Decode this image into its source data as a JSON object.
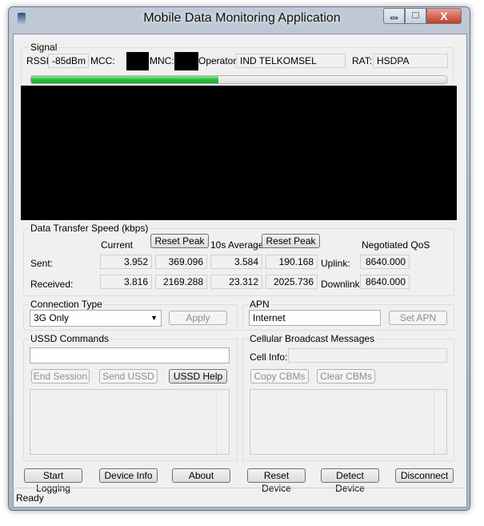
{
  "window": {
    "title": "Mobile Data Monitoring Application",
    "minimize": "minimize",
    "maximize": "maximize",
    "close": "X"
  },
  "signal": {
    "group": "Signal",
    "rssi_label": "RSSI:",
    "rssi": "-85dBm",
    "mcc_label": "MCC:",
    "mnc_label": "MNC:",
    "operator_label": "Operator:",
    "operator": "IND TELKOMSEL",
    "rat_label": "RAT:",
    "rat": "HSDPA",
    "strength_percent": 45,
    "bar_color": "#22c43a"
  },
  "speed": {
    "group": "Data Transfer Speed (kbps)",
    "current": "Current",
    "reset_peak": "Reset Peak",
    "avg": "10s Average",
    "reset_peak2": "Reset Peak",
    "qos": "Negotiated QoS",
    "sent": "Sent:",
    "received": "Received:",
    "uplink": "Uplink:",
    "downlink": "Downlink:",
    "sent_values": [
      "3.952",
      "369.096",
      "3.584",
      "190.168"
    ],
    "received_values": [
      "3.816",
      "2169.288",
      "23.312",
      "2025.736"
    ],
    "uplink_value": "8640.000",
    "downlink_value": "8640.000"
  },
  "connection": {
    "group": "Connection Type",
    "selected": "3G Only",
    "apply": "Apply"
  },
  "apn": {
    "group": "APN",
    "value": "Internet",
    "set": "Set APN"
  },
  "ussd": {
    "group": "USSD Commands",
    "input": "",
    "end": "End Session",
    "send": "Send USSD",
    "help": "USSD Help"
  },
  "cbm": {
    "group": "Cellular Broadcast Messages",
    "cell_info_label": "Cell Info:",
    "cell_info": "",
    "copy": "Copy CBMs",
    "clear": "Clear CBMs"
  },
  "bottom": [
    "Start Logging",
    "Device Info",
    "About",
    "Reset Device",
    "Detect Device",
    "Disconnect"
  ],
  "status": "Ready"
}
